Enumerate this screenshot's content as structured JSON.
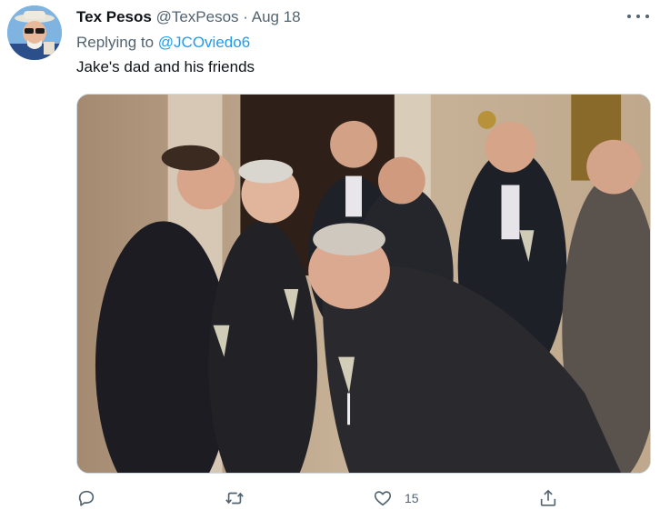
{
  "tweet": {
    "author_name": "Tex Pesos",
    "author_handle": "@TexPesos",
    "separator": "·",
    "date": "Aug 18",
    "replying_to_prefix": "Replying to",
    "replying_to_handle": "@JCOviedo6",
    "text": "Jake's dad and his friends"
  },
  "actions": {
    "reply_icon": "reply-icon",
    "retweet_icon": "retweet-icon",
    "like_icon": "heart-icon",
    "like_count": "15",
    "share_icon": "share-icon"
  },
  "colors": {
    "link": "#1d9bf0",
    "secondary_text": "#536471",
    "primary_text": "#0f1419"
  }
}
